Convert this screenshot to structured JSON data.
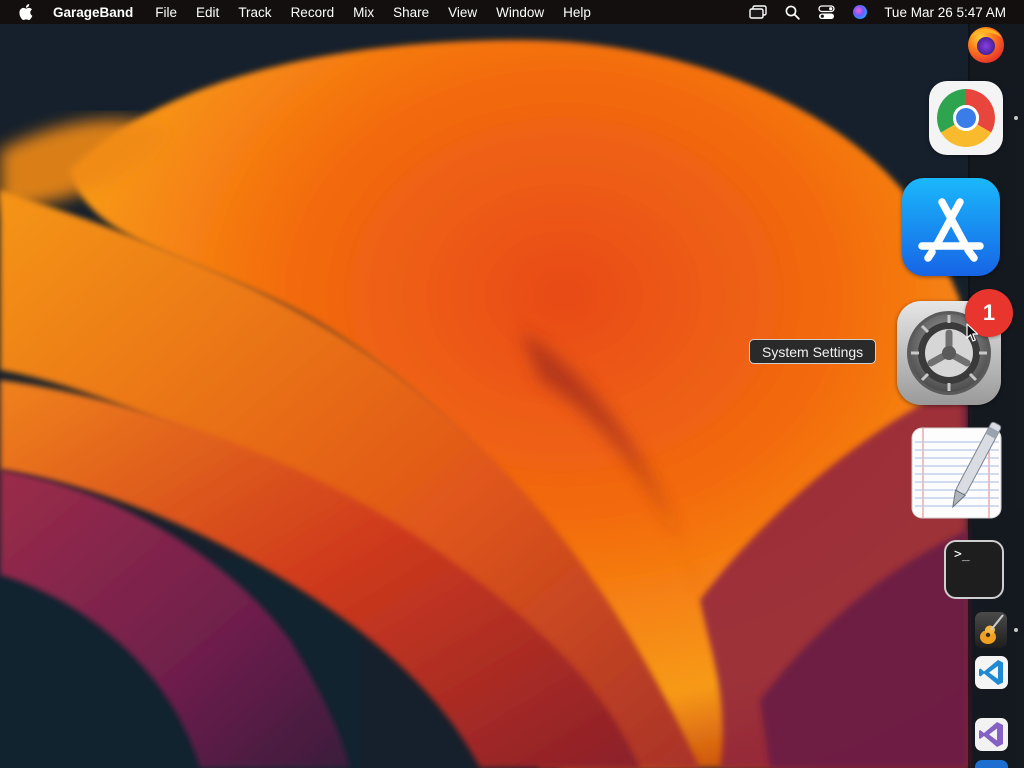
{
  "menubar": {
    "app_name": "GarageBand",
    "menus": [
      "File",
      "Edit",
      "Track",
      "Record",
      "Mix",
      "Share",
      "View",
      "Window",
      "Help"
    ],
    "status_icons": [
      "screen-mirroring-icon",
      "spotlight-search-icon",
      "control-center-icon",
      "siri-icon"
    ],
    "clock": "Tue Mar 26  5:47 AM"
  },
  "dock": {
    "apps": [
      {
        "name": "Firefox",
        "icon": "firefox-icon",
        "running": false
      },
      {
        "name": "Google Chrome",
        "icon": "chrome-icon",
        "running": true
      },
      {
        "name": "App Store",
        "icon": "app-store-icon",
        "running": false
      },
      {
        "name": "System Settings",
        "icon": "system-settings-icon",
        "running": false,
        "badge": "1"
      },
      {
        "name": "TextEdit",
        "icon": "textedit-icon",
        "running": false
      },
      {
        "name": "Terminal",
        "icon": "terminal-icon",
        "running": false,
        "glyph": ">_"
      },
      {
        "name": "GarageBand",
        "icon": "garageband-icon",
        "running": true
      },
      {
        "name": "Visual Studio Code",
        "icon": "vscode-icon",
        "running": false
      },
      {
        "name": "Visual Studio",
        "icon": "visual-studio-icon",
        "running": false
      }
    ]
  },
  "tooltip": {
    "text": "System Settings"
  },
  "colors": {
    "wallpaper_orange": "#f07a12",
    "wallpaper_red": "#c8321c",
    "wallpaper_magenta": "#7a2050",
    "wallpaper_dark": "#16202c",
    "badge_red": "#e8352e"
  }
}
